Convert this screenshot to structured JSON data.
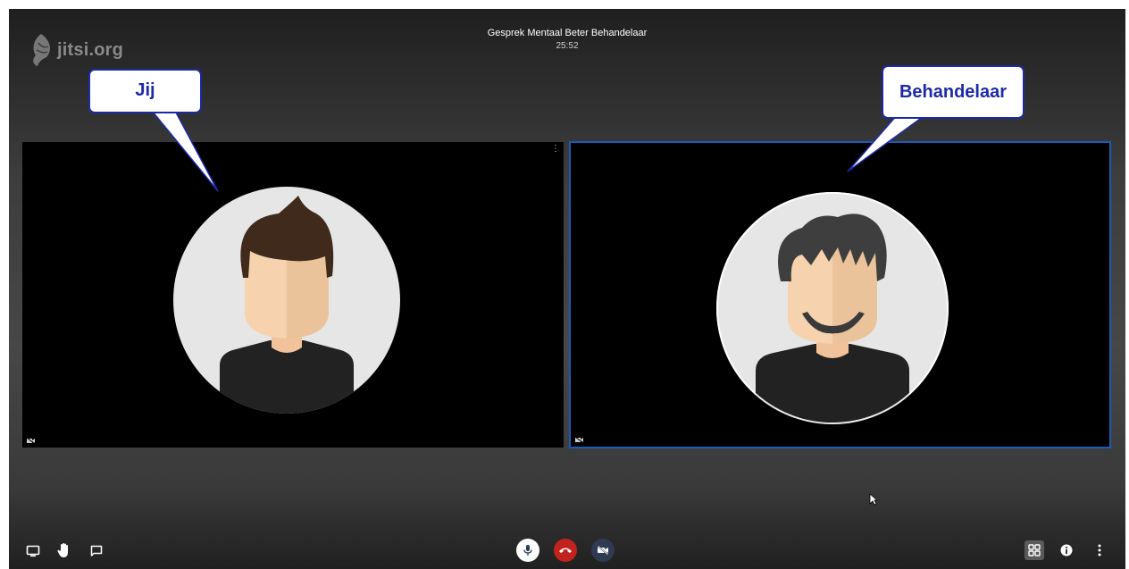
{
  "app": {
    "logo_text": "jitsi.org"
  },
  "conference": {
    "title": "Gesprek Mentaal Beter Behandelaar",
    "timer": "25:52"
  },
  "participants": [
    {
      "role": "local",
      "callout": "Jij"
    },
    {
      "role": "remote",
      "callout": "Behandelaar"
    }
  ],
  "toolbar": {
    "left": [
      {
        "icon": "screen-share-icon"
      },
      {
        "icon": "raise-hand-icon"
      },
      {
        "icon": "chat-icon"
      }
    ],
    "center": [
      {
        "icon": "microphone-icon"
      },
      {
        "icon": "hangup-icon"
      },
      {
        "icon": "camera-off-icon"
      }
    ],
    "right": [
      {
        "icon": "tile-view-icon"
      },
      {
        "icon": "info-icon"
      },
      {
        "icon": "more-icon"
      }
    ]
  },
  "colors": {
    "callout_border": "#1d2aa8",
    "callout_text": "#1d2aa8",
    "active_speaker_border": "#1a5bb5",
    "hangup_red": "#c3231d",
    "mic_bg": "#ffffff",
    "camera_bg": "#2f3a53"
  }
}
